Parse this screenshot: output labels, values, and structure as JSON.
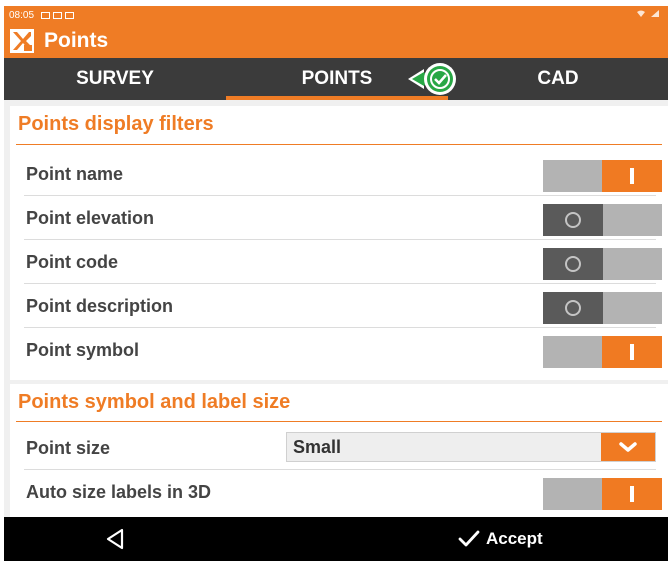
{
  "status_bar": {
    "time": "08:05",
    "left_icons": [
      "image-icon",
      "calendar-icon",
      "message-icon"
    ],
    "right_icons": [
      "wifi-icon",
      "signal-icon"
    ]
  },
  "app_bar": {
    "logo_icon": "xpad-logo",
    "title": "Points"
  },
  "tabs": {
    "items": [
      {
        "label": "SURVEY",
        "active": false
      },
      {
        "label": "POINTS",
        "active": true
      },
      {
        "label": "CAD",
        "active": false
      }
    ],
    "badge_icon": "check-circle-icon"
  },
  "sections": [
    {
      "title": "Points display filters",
      "rows": [
        {
          "label": "Point name",
          "toggle": "on"
        },
        {
          "label": "Point elevation",
          "toggle": "off"
        },
        {
          "label": "Point code",
          "toggle": "off"
        },
        {
          "label": "Point description",
          "toggle": "off"
        },
        {
          "label": "Point symbol",
          "toggle": "on"
        }
      ]
    },
    {
      "title": "Points symbol and label size",
      "point_size": {
        "label": "Point size",
        "value": "Small",
        "icon": "chevron-down-icon"
      },
      "auto_size": {
        "label": "Auto size labels in 3D",
        "toggle": "on"
      }
    }
  ],
  "bottom_bar": {
    "back_icon": "back-triangle-icon",
    "accept_icon": "check-icon",
    "accept_label": "Accept"
  },
  "colors": {
    "accent": "#ef7c25",
    "tab_bar": "#3b3b3b",
    "toggle_on": "#f07a22",
    "toggle_off": "#5a5a5a",
    "toggle_track": "#b3b3b3",
    "badge_green": "#28a745"
  }
}
